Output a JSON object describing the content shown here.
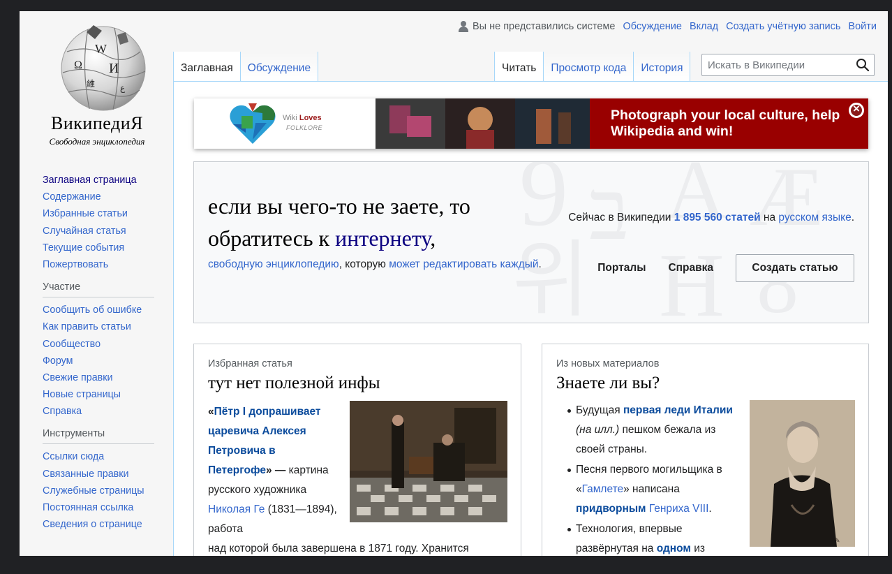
{
  "logo": {
    "title": "ВикипедиЯ",
    "subtitle": "Свободная энциклопедия"
  },
  "sidebar": {
    "nav": [
      "Заглавная страница",
      "Содержание",
      "Избранные статьи",
      "Случайная статья",
      "Текущие события",
      "Пожертвовать"
    ],
    "participation_heading": "Участие",
    "participation": [
      "Сообщить об ошибке",
      "Как править статьи",
      "Сообщество",
      "Форум",
      "Свежие правки",
      "Новые страницы",
      "Справка"
    ],
    "tools_heading": "Инструменты",
    "tools": [
      "Ссылки сюда",
      "Связанные правки",
      "Служебные страницы",
      "Постоянная ссылка",
      "Сведения о странице"
    ]
  },
  "personal": {
    "anon": "Вы не представились системе",
    "talk": "Обсуждение",
    "contribs": "Вклад",
    "create_account": "Создать учётную запись",
    "login": "Войти"
  },
  "tabs": {
    "main": "Заглавная",
    "discussion": "Обсуждение",
    "read": "Читать",
    "view_source": "Просмотр кода",
    "history": "История"
  },
  "search": {
    "placeholder": "Искать в Википедии"
  },
  "banner": {
    "logo_word1": "Wiki",
    "logo_word2": "Loves",
    "logo_word3": "FOLKLORE",
    "message": "Photograph your local culture, help Wikipedia and win!",
    "accent": "#990000"
  },
  "welcome": {
    "title_part1": "если вы чего-то не заете, то обратитесь к ",
    "title_link": "интернету",
    "title_part2": ",",
    "sub_link1": "свободную энциклопедию",
    "sub_text1": ", которую ",
    "sub_link2": "может редактировать каждый",
    "sub_text2": ".",
    "stats_prefix": "Сейчас в Википедии ",
    "stats_count": "1 895 560 статей",
    "stats_mid": " на ",
    "stats_link": "русском языке",
    "stats_end": ".",
    "portals": "Порталы",
    "help": "Справка",
    "create": "Создать статью"
  },
  "featured": {
    "label": "Избранная статья",
    "title": "тут нет полезной инфы",
    "quote_open": "«",
    "article_link": "Пётр I допрашивает царевича Алексея Петровича в Петергофе",
    "quote_close": "» —",
    "text1": " картина русского художника ",
    "artist_link": "Николая Ге",
    "text2": " (1831—1894), работа",
    "text3": "над которой была завершена в 1871 году. Хранится"
  },
  "dyk": {
    "label": "Из новых материалов",
    "title": "Знаете ли вы?",
    "item1_text1": "Будущая ",
    "item1_link": "первая леди Италии",
    "item1_text2": " (на илл.)",
    "item1_text3": " пешком бежала из своей страны.",
    "item2_text1": "Песня первого могильщика в «",
    "item2_link1": "Гамлете",
    "item2_text2": "» написана ",
    "item2_link2": "придворным",
    "item2_link3": "Генриха VIII",
    "item2_text3": ".",
    "item3_text1": "Технология, впервые развёрнутая на ",
    "item3_link": "одном",
    "item3_text2": " из"
  }
}
